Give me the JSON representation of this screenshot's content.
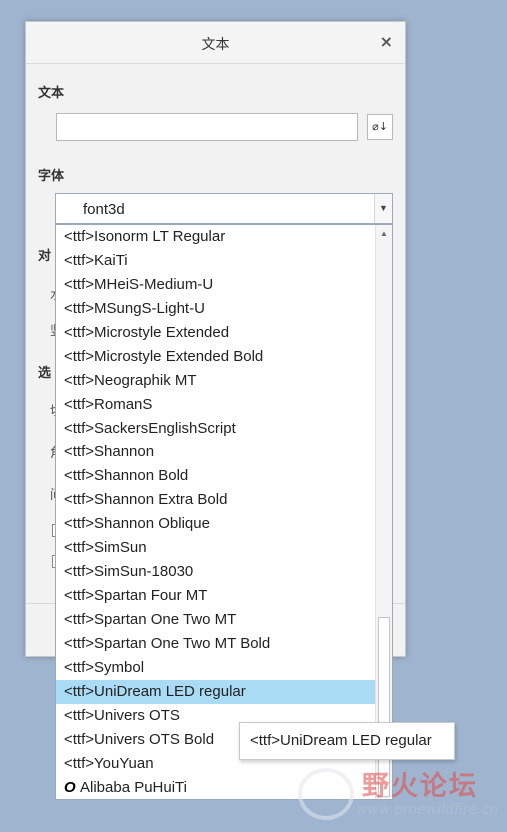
{
  "dialog": {
    "title": "文本",
    "close_glyph": "×",
    "text_section_label": "文本",
    "text_value": "",
    "symbol_button_glyph": "⌀↓",
    "font_section_label": "字体",
    "partial_labels": [
      "对",
      "水",
      "竖",
      "选",
      "切",
      "角",
      "间"
    ]
  },
  "font_combo": {
    "selected": "font3d",
    "arrow_glyph": "▼"
  },
  "font_list": {
    "items": [
      "<ttf>Isonorm LT Regular",
      "<ttf>KaiTi",
      "<ttf>MHeiS-Medium-U",
      "<ttf>MSungS-Light-U",
      "<ttf>Microstyle Extended",
      "<ttf>Microstyle Extended Bold",
      "<ttf>Neographik MT",
      "<ttf>RomanS",
      "<ttf>SackersEnglishScript",
      "<ttf>Shannon",
      "<ttf>Shannon Bold",
      "<ttf>Shannon Extra Bold",
      "<ttf>Shannon Oblique",
      "<ttf>SimSun",
      "<ttf>SimSun-18030",
      "<ttf>Spartan Four MT",
      "<ttf>Spartan One Two MT",
      "<ttf>Spartan One Two MT Bold",
      "<ttf>Symbol",
      "<ttf>UniDream LED regular",
      "<ttf>Univers OTS",
      "<ttf>Univers OTS Bold",
      "<ttf>YouYuan"
    ],
    "selected_index": 19,
    "otf_item": {
      "glyph": "O",
      "label": "Alibaba PuHuiTi"
    }
  },
  "tooltip": {
    "text": "<ttf>UniDream LED regular"
  },
  "watermark": {
    "brand_cn": "野火论坛",
    "url": "www.proewildfire.cn"
  },
  "colors": {
    "background": "#9fb5cf",
    "selection": "#a9dbf5",
    "watermark_red": "#e14a4a"
  }
}
